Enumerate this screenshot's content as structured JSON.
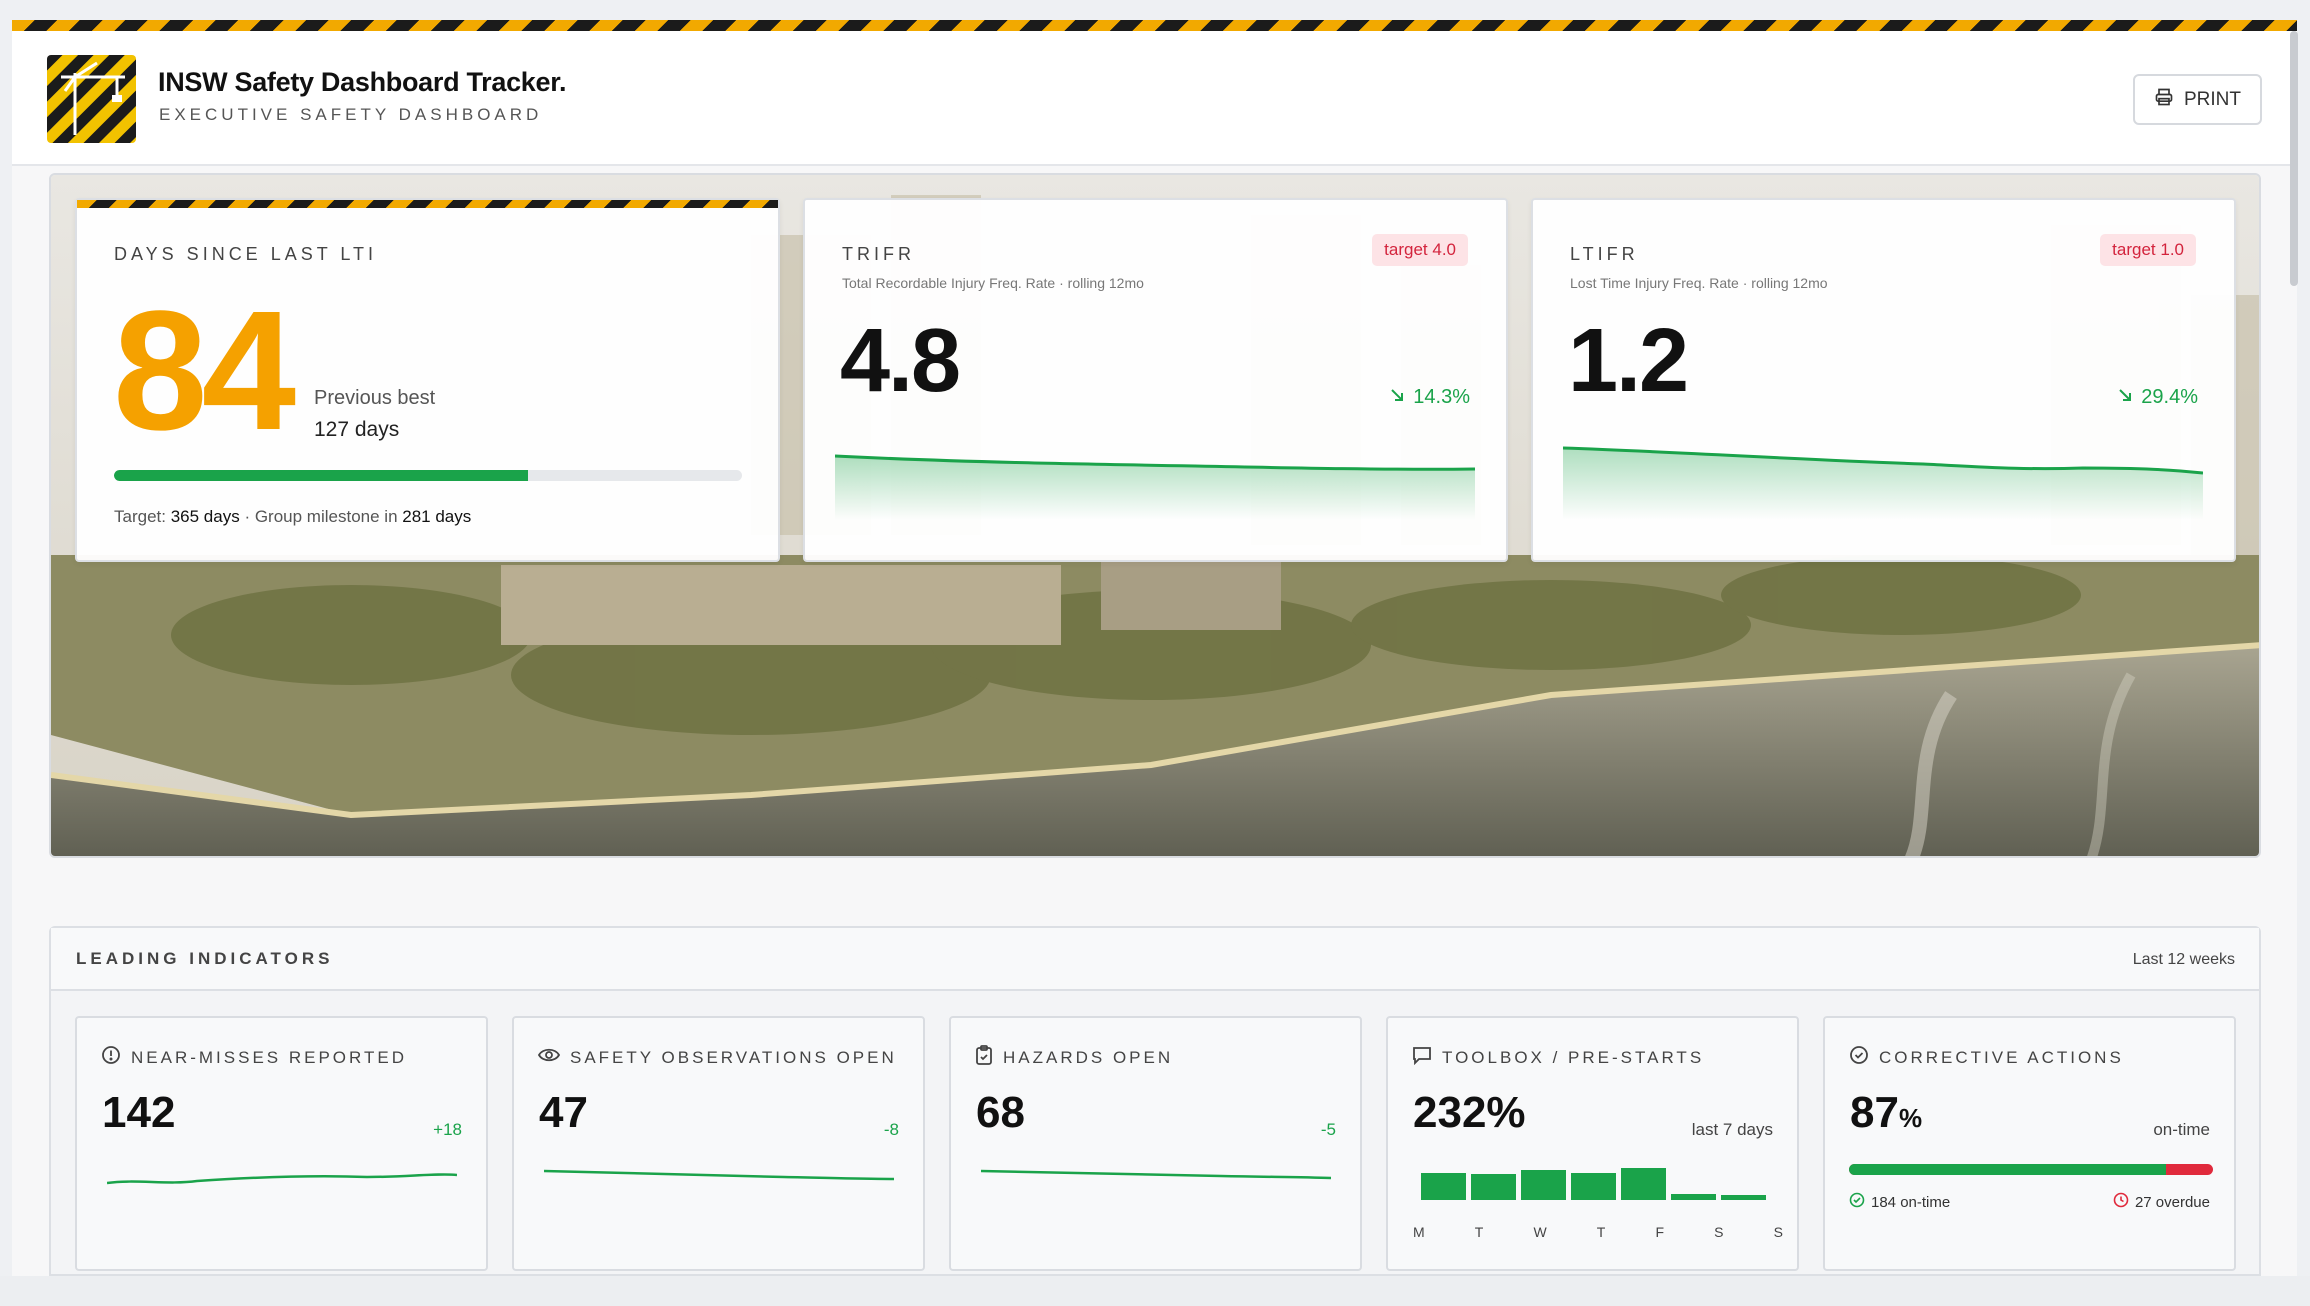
{
  "app": {
    "title": "INSW Safety Dashboard Tracker.",
    "subtitle": "EXECUTIVE SAFETY DASHBOARD",
    "print_label": "PRINT"
  },
  "kpis": {
    "lti": {
      "label": "DAYS SINCE LAST LTI",
      "value": "84",
      "previous_best_label": "Previous best",
      "previous_best_value": "127 days",
      "progress_fraction": 0.66,
      "foot_target_prefix": "Target:",
      "foot_target_value": "365 days",
      "foot_middle": "· Group milestone in",
      "foot_milestone_value": "281 days"
    },
    "trifr": {
      "label": "TRIFR",
      "subtitle": "Total Recordable Injury Freq. Rate · rolling 12mo",
      "target": "target 4.0",
      "value": "4.8",
      "delta": "14.3%"
    },
    "ltifr": {
      "label": "LTIFR",
      "subtitle": "Lost Time Injury Freq. Rate · rolling 12mo",
      "target": "target 1.0",
      "value": "1.2",
      "delta": "29.4%"
    }
  },
  "leading": {
    "title": "LEADING INDICATORS",
    "period": "Last 12 weeks",
    "near_misses": {
      "label": "NEAR-MISSES REPORTED",
      "value": "142",
      "delta": "+18"
    },
    "observations": {
      "label": "SAFETY OBSERVATIONS OPEN",
      "value": "47",
      "delta": "-8"
    },
    "hazards": {
      "label": "HAZARDS OPEN",
      "value": "68",
      "delta": "-5"
    },
    "toolbox": {
      "label": "TOOLBOX / PRE-STARTS",
      "value": "232%",
      "note": "last 7 days",
      "days": [
        "M",
        "T",
        "W",
        "T",
        "F",
        "S",
        "S"
      ],
      "bar_levels": [
        0.85,
        0.8,
        0.95,
        0.85,
        1.0,
        0.2,
        0.15
      ]
    },
    "corrective": {
      "label": "CORRECTIVE ACTIONS",
      "value_number": "87",
      "value_unit": "%",
      "note": "on-time",
      "ontime_fraction": 0.87,
      "ontime_text": "184 on-time",
      "overdue_text": "27 overdue"
    }
  },
  "colors": {
    "hazard_yellow": "#f2a900",
    "lti_orange": "#f5a100",
    "good_green": "#1aa34a",
    "bad_red": "#e02a3c",
    "target_red_bg": "#fde3e6"
  }
}
